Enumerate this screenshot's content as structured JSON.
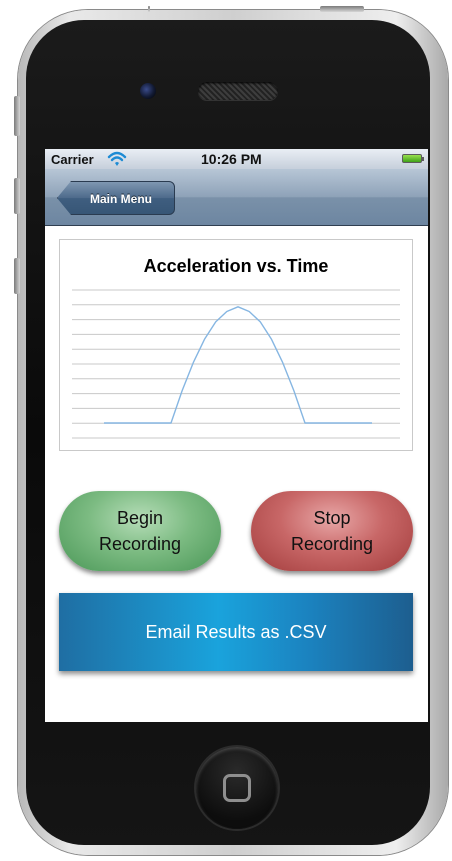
{
  "status_bar": {
    "carrier": "Carrier",
    "time": "10:26 PM"
  },
  "nav_bar": {
    "back_label": "Main Menu"
  },
  "chart_data": {
    "type": "line",
    "title": "Acceleration vs. Time",
    "xlabel": "",
    "ylabel": "",
    "grid": "horizontal lines",
    "series": [
      {
        "values": [
          0,
          0,
          0,
          0,
          0,
          0,
          0,
          0.28,
          0.52,
          0.72,
          0.87,
          0.96,
          1.0,
          0.96,
          0.87,
          0.72,
          0.52,
          0.28,
          0,
          0,
          0,
          0,
          0,
          0,
          0
        ],
        "color": "#86b6e2"
      }
    ],
    "x": [
      0,
      0.5,
      1,
      1.5,
      2,
      2.5,
      3,
      3.5,
      4,
      4.5,
      5,
      5.5,
      6,
      6.5,
      7,
      7.5,
      8,
      8.5,
      9,
      9.5,
      10,
      10.5,
      11,
      11.5,
      12
    ],
    "ylim": [
      0,
      1.05
    ]
  },
  "buttons": {
    "begin": "Begin Recording",
    "stop": "Stop Recording",
    "email": "Email Results as .CSV"
  },
  "colors": {
    "begin_button": "#6fae77",
    "stop_button": "#bd5a5a",
    "email_button": "#1a8fcc",
    "nav_bar": "#8ea2b8"
  },
  "icons": {
    "wifi": "wifi-icon",
    "battery": "battery-icon",
    "home": "home-button-icon"
  }
}
